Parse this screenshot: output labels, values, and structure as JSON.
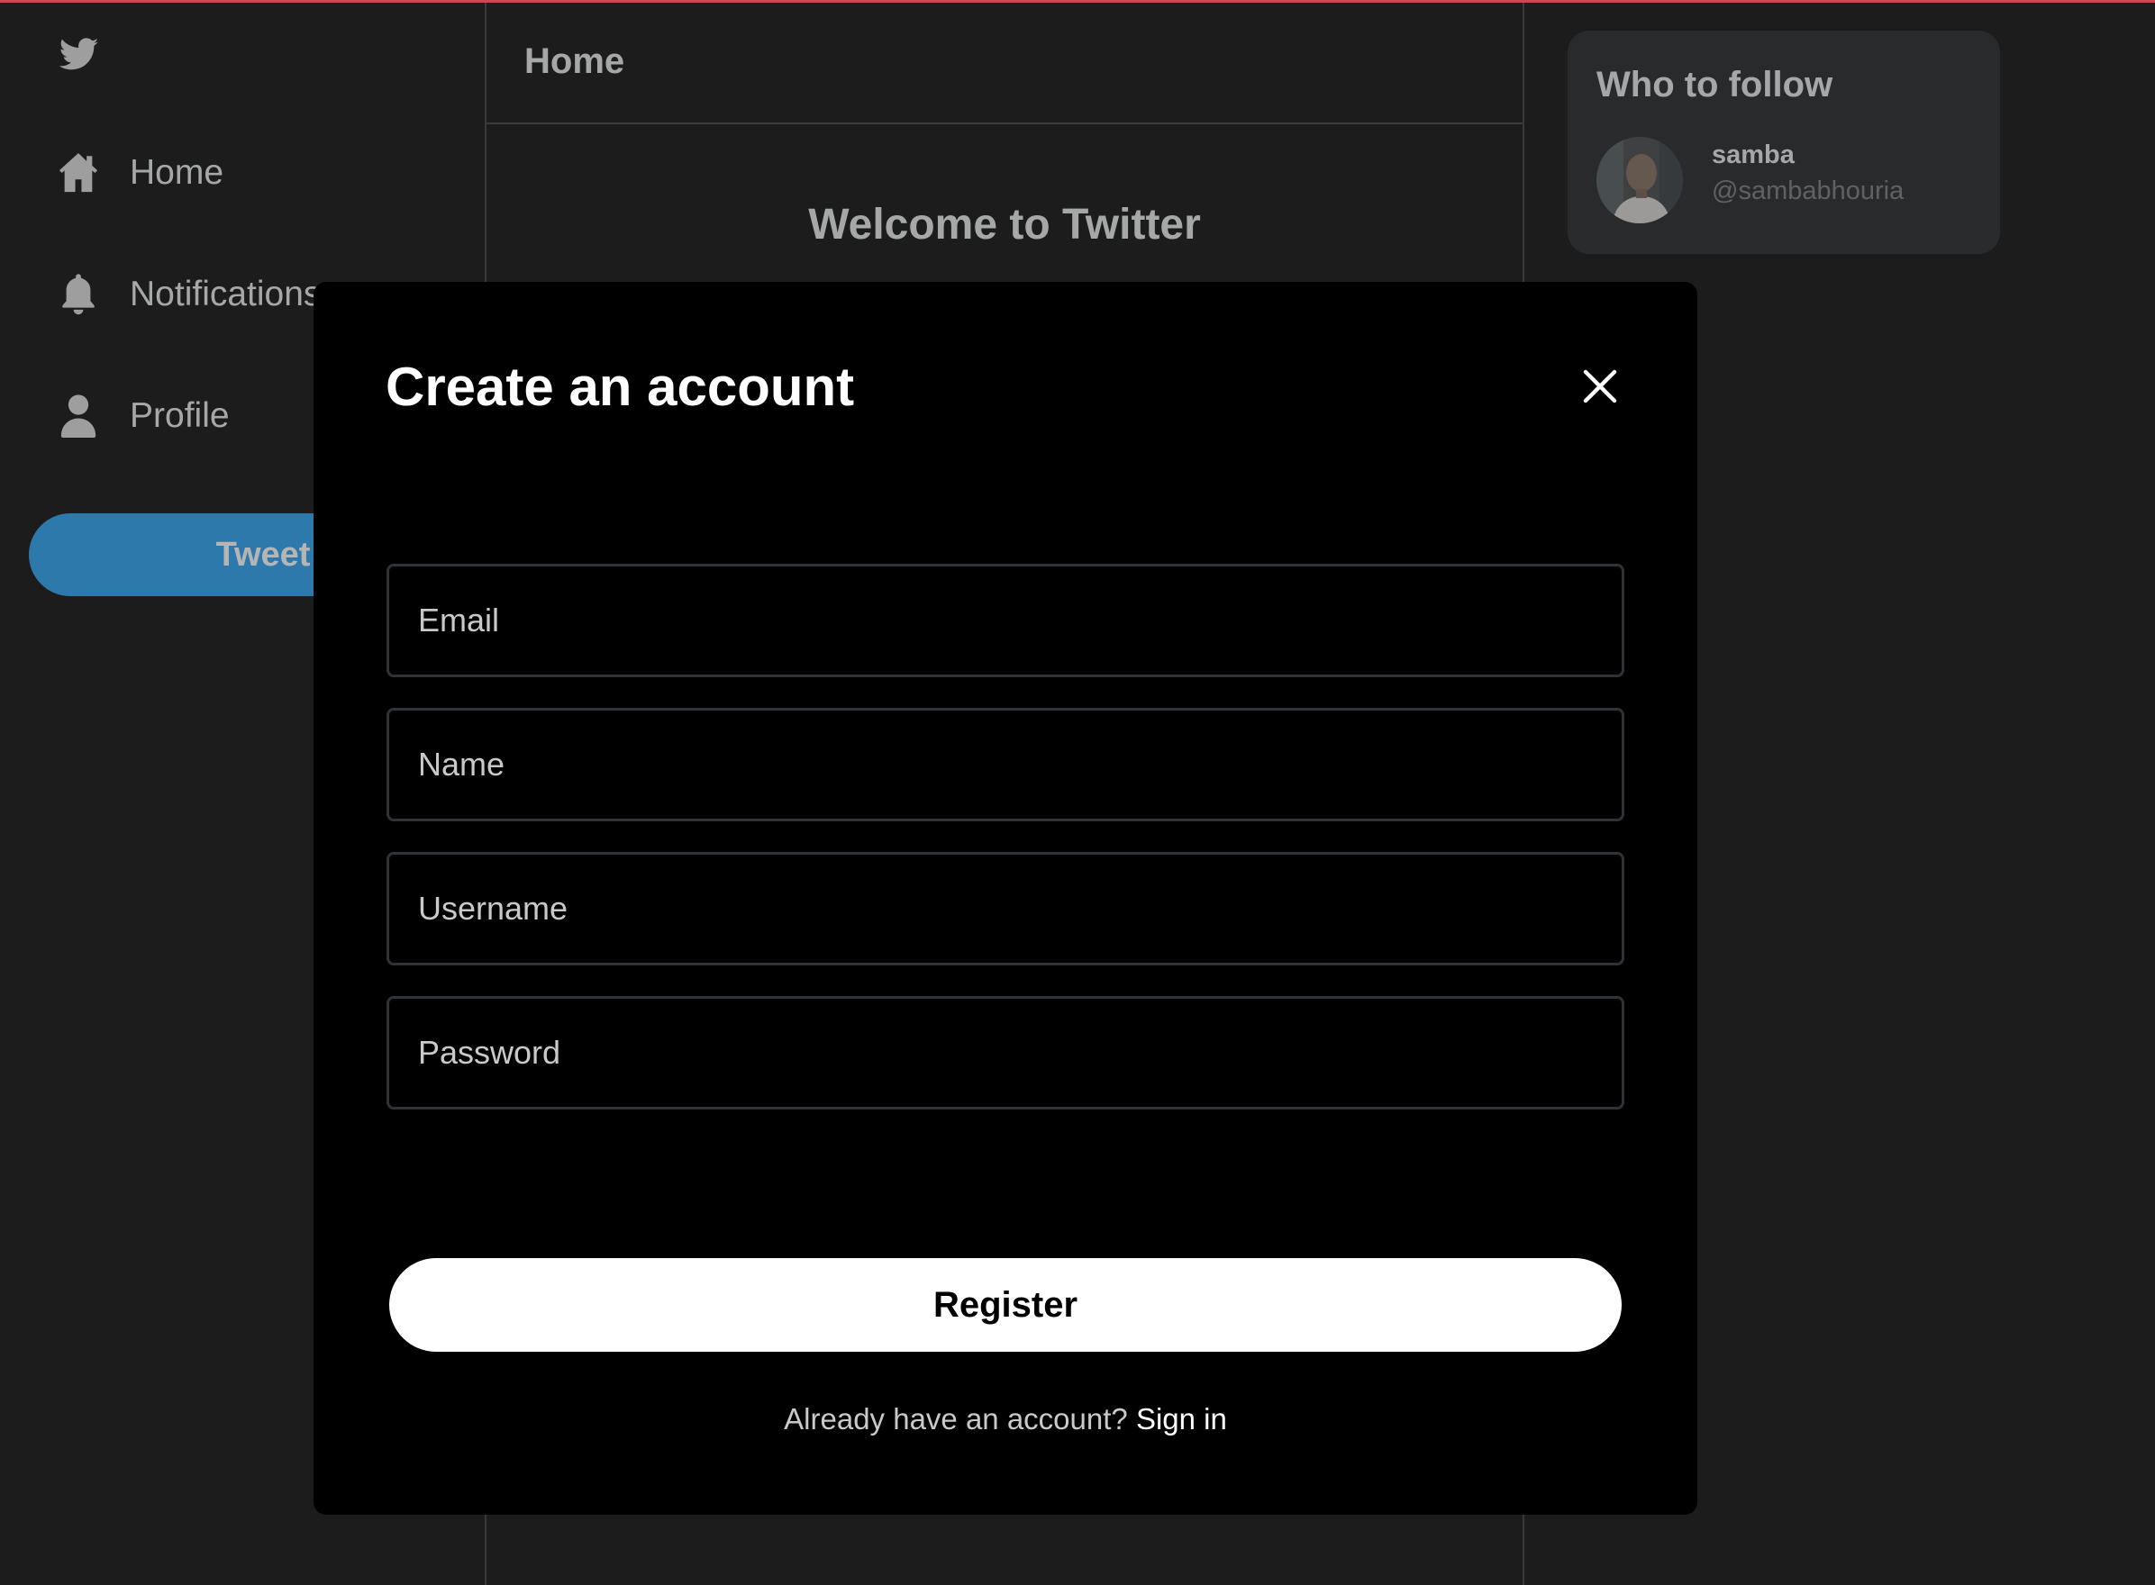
{
  "sidebar": {
    "logo_icon": "twitter-bird-icon",
    "items": [
      {
        "label": "Home",
        "icon": "home-icon"
      },
      {
        "label": "Notifications",
        "icon": "bell-icon"
      },
      {
        "label": "Profile",
        "icon": "user-icon"
      }
    ],
    "tweet_label": "Tweet"
  },
  "main": {
    "title": "Home",
    "welcome": "Welcome to Twitter"
  },
  "who_to_follow": {
    "title": "Who to follow",
    "users": [
      {
        "name": "samba",
        "handle": "@sambabhouria"
      }
    ]
  },
  "modal": {
    "title": "Create an account",
    "close_icon": "close-icon",
    "fields": [
      {
        "name": "email",
        "placeholder": "Email",
        "value": ""
      },
      {
        "name": "name",
        "placeholder": "Name",
        "value": ""
      },
      {
        "name": "username",
        "placeholder": "Username",
        "value": ""
      },
      {
        "name": "password",
        "placeholder": "Password",
        "value": ""
      }
    ],
    "register_label": "Register",
    "signin_prompt": "Already have an account?",
    "signin_link": "Sign in"
  },
  "colors": {
    "accent": "#1d9bf0",
    "background": "#000000",
    "border": "#2f3336",
    "top_line": "#c94a52"
  }
}
